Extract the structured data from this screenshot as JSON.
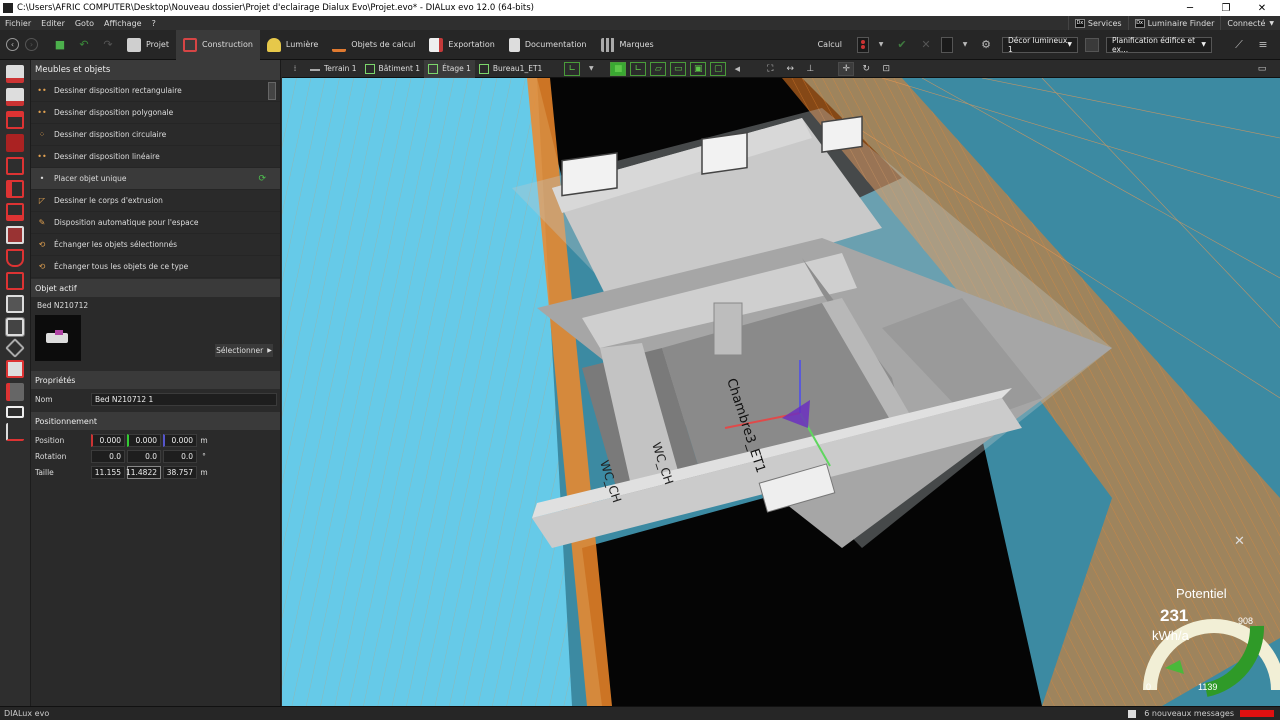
{
  "window": {
    "title": "C:\\Users\\AFRIC COMPUTER\\Desktop\\Nouveau dossier\\Projet d'eclairage Dialux Evo\\Projet.evo* - DIALux evo 12.0  (64-bits)",
    "minimize": "─",
    "maximize": "❐",
    "close": "✕"
  },
  "menu": {
    "items": [
      "Fichier",
      "Editer",
      "Goto",
      "Affichage",
      "?"
    ],
    "services": "Services",
    "luminaire_finder": "Luminaire Finder",
    "connected": "Connecté"
  },
  "toolbar": {
    "tabs": [
      {
        "label": "Projet",
        "color": "#cccccc"
      },
      {
        "label": "Construction",
        "color": "#d64545"
      },
      {
        "label": "Lumière",
        "color": "#e6c84a"
      },
      {
        "label": "Objets de calcul",
        "color": "#e07a30"
      },
      {
        "label": "Exportation",
        "color": "#c43a3a"
      },
      {
        "label": "Documentation",
        "color": "#dddddd"
      },
      {
        "label": "Marques",
        "color": "#aaaaaa"
      }
    ],
    "calc_label": "Calcul",
    "scene_select": "Décor lumineux 1",
    "planning_select": "Planification édifice et ex..."
  },
  "breadcrumb": [
    "Terrain 1",
    "Bâtiment 1",
    "Étage 1",
    "Bureau1_ET1"
  ],
  "left_panel": {
    "header": "Meubles et objets",
    "tools": [
      {
        "label": "Dessiner disposition rectangulaire",
        "icon": "••"
      },
      {
        "label": "Dessiner disposition polygonale",
        "icon": "••"
      },
      {
        "label": "Dessiner disposition circulaire",
        "icon": "⁘"
      },
      {
        "label": "Dessiner disposition linéaire",
        "icon": "••"
      },
      {
        "label": "Placer objet unique",
        "icon": "•"
      },
      {
        "label": "Dessiner le corps d'extrusion",
        "icon": "◸"
      },
      {
        "label": "Disposition automatique pour l'espace",
        "icon": "✎"
      },
      {
        "label": "Échanger les objets sélectionnés",
        "icon": "⟲"
      },
      {
        "label": "Échanger tous les objets de ce type",
        "icon": "⟲"
      }
    ],
    "active_object_header": "Objet actif",
    "active_object_name": "Bed N210712",
    "select_button": "Sélectionner",
    "properties_header": "Propriétés",
    "name_label": "Nom",
    "name_value": "Bed N210712 1",
    "positioning_header": "Positionnement",
    "position_label": "Position",
    "position": [
      "0.000",
      "0.000",
      "0.000"
    ],
    "rotation_label": "Rotation",
    "rotation": [
      "0.0",
      "0.0",
      "0.0"
    ],
    "size_label": "Taille",
    "size": [
      "11.155",
      "11.4822",
      "38.757"
    ],
    "unit_m": "m",
    "unit_deg": "°"
  },
  "viewport": {
    "room_labels": [
      "Chambre3_ET1",
      "WC_CH",
      "WC_CH"
    ],
    "close_glyph": "✕"
  },
  "gauge": {
    "title": "Potentiel",
    "value": "231",
    "unit": "kWh/a",
    "min": "0",
    "max": "1139",
    "mark": "908"
  },
  "status": {
    "app": "DIALux evo",
    "messages": "6 nouveaux messages"
  }
}
